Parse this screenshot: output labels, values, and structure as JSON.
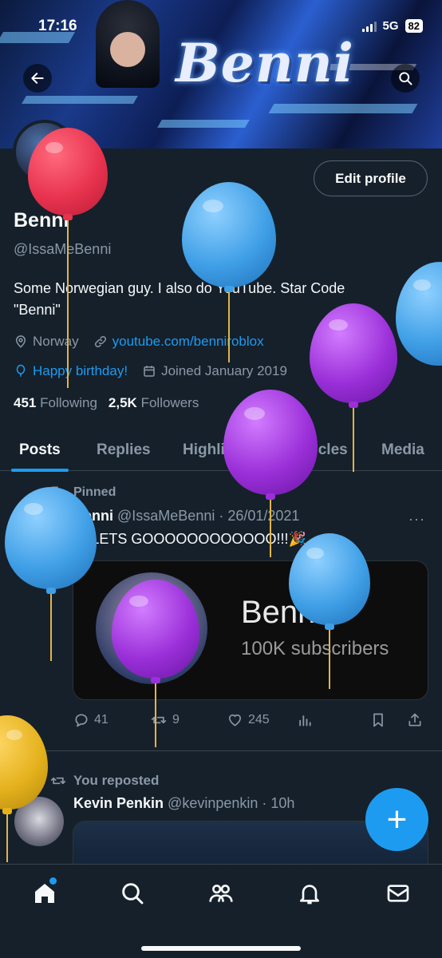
{
  "status_bar": {
    "time": "17:16",
    "network": "5G",
    "battery": "82"
  },
  "banner": {
    "brand_text": "Benni"
  },
  "profile": {
    "edit_button": "Edit profile",
    "name": "Benni",
    "handle": "@IssaMeBenni",
    "bio_line1": "Some Norwegian guy. I also do YouTube. Star Code",
    "bio_line2": "\"Benni\"",
    "location": "Norway",
    "website": "youtube.com/benniroblox",
    "birthday": "Happy birthday!",
    "joined": "Joined January 2019",
    "following_count": "451",
    "following_label": "Following",
    "followers_count": "2,5K",
    "followers_label": "Followers"
  },
  "tabs": [
    "Posts",
    "Replies",
    "Highlights",
    "Articles",
    "Media"
  ],
  "pinned_post": {
    "pinned_label": "Pinned",
    "author": "Benni",
    "handle": "@IssaMeBenni",
    "separator": "·",
    "date": "26/01/2021",
    "text": "🎉LETS GOOOOOOOOOOOO!!!🎉",
    "more": "···",
    "card_title": "Benni",
    "card_subtitle": "100K subscribers",
    "replies": "41",
    "reposts": "9",
    "likes": "245"
  },
  "repost": {
    "label": "You reposted",
    "author": "Kevin Penkin",
    "handle": "@kevinpenkin",
    "separator": "·",
    "time": "10h"
  },
  "fab": {
    "label": "+"
  },
  "colors": {
    "background": "#15202b",
    "accent": "#1d9bf0",
    "secondary_text": "#8b98a5",
    "balloon_red": "#e8334e",
    "balloon_blue": "#3f9fe6",
    "balloon_purple": "#9b30d9",
    "balloon_yellow": "#e5b21d"
  },
  "icons": {
    "back": "arrow-left-icon",
    "search": "search-icon",
    "location": "location-pin-icon",
    "link": "link-icon",
    "balloon": "balloon-icon",
    "calendar": "calendar-icon",
    "reply": "reply-icon",
    "repost": "repost-icon",
    "like": "heart-icon",
    "views": "analytics-icon",
    "bookmark": "bookmark-icon",
    "share": "share-icon",
    "nav": [
      "home-icon",
      "search-icon",
      "communities-icon",
      "bell-icon",
      "mail-icon"
    ]
  }
}
